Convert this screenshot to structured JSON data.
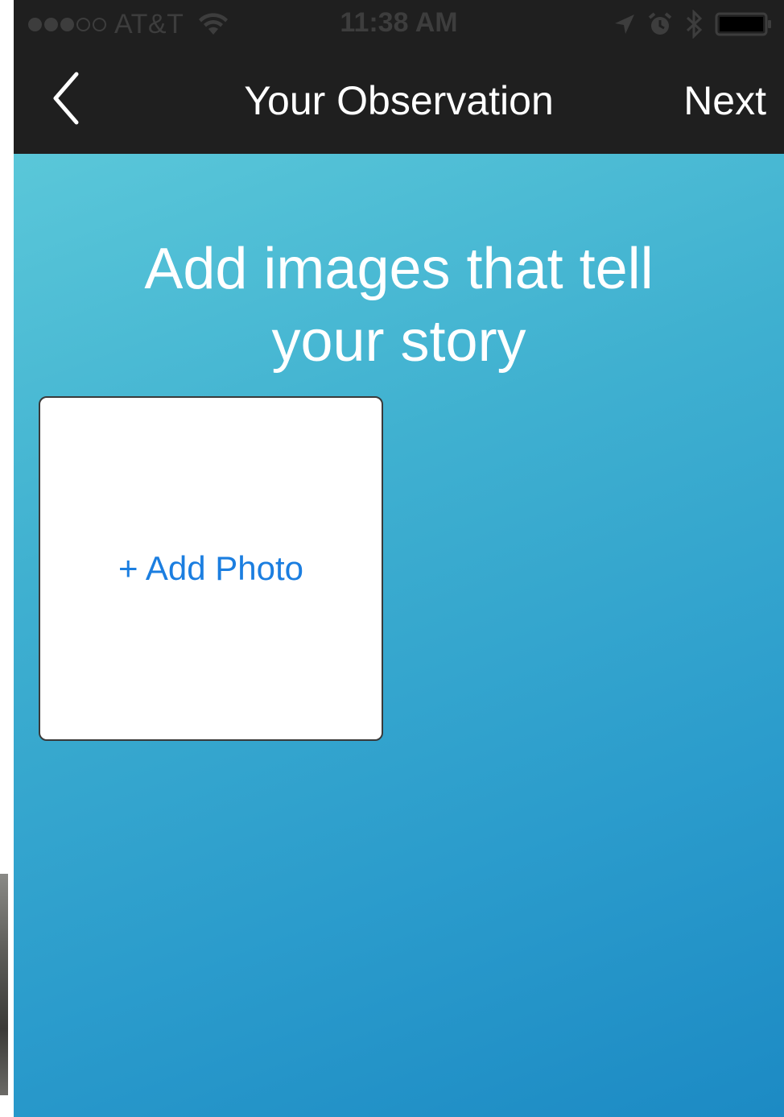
{
  "status_bar": {
    "carrier": "AT&T",
    "time": "11:38 AM",
    "signal_filled": 3,
    "signal_total": 5
  },
  "nav": {
    "title": "Your Observation",
    "next_label": "Next"
  },
  "content": {
    "headline": "Add images that tell your story",
    "add_photo_label": "+ Add Photo"
  },
  "colors": {
    "nav_background": "#1f1f1f",
    "gradient_start": "#5ac7d9",
    "gradient_end": "#1c8ac4",
    "link_blue": "#1b7ee0"
  },
  "icons": {
    "back": "chevron-left-icon",
    "wifi": "wifi-icon",
    "location": "location-arrow-icon",
    "alarm": "alarm-clock-icon",
    "bluetooth": "bluetooth-icon",
    "battery": "battery-icon"
  }
}
